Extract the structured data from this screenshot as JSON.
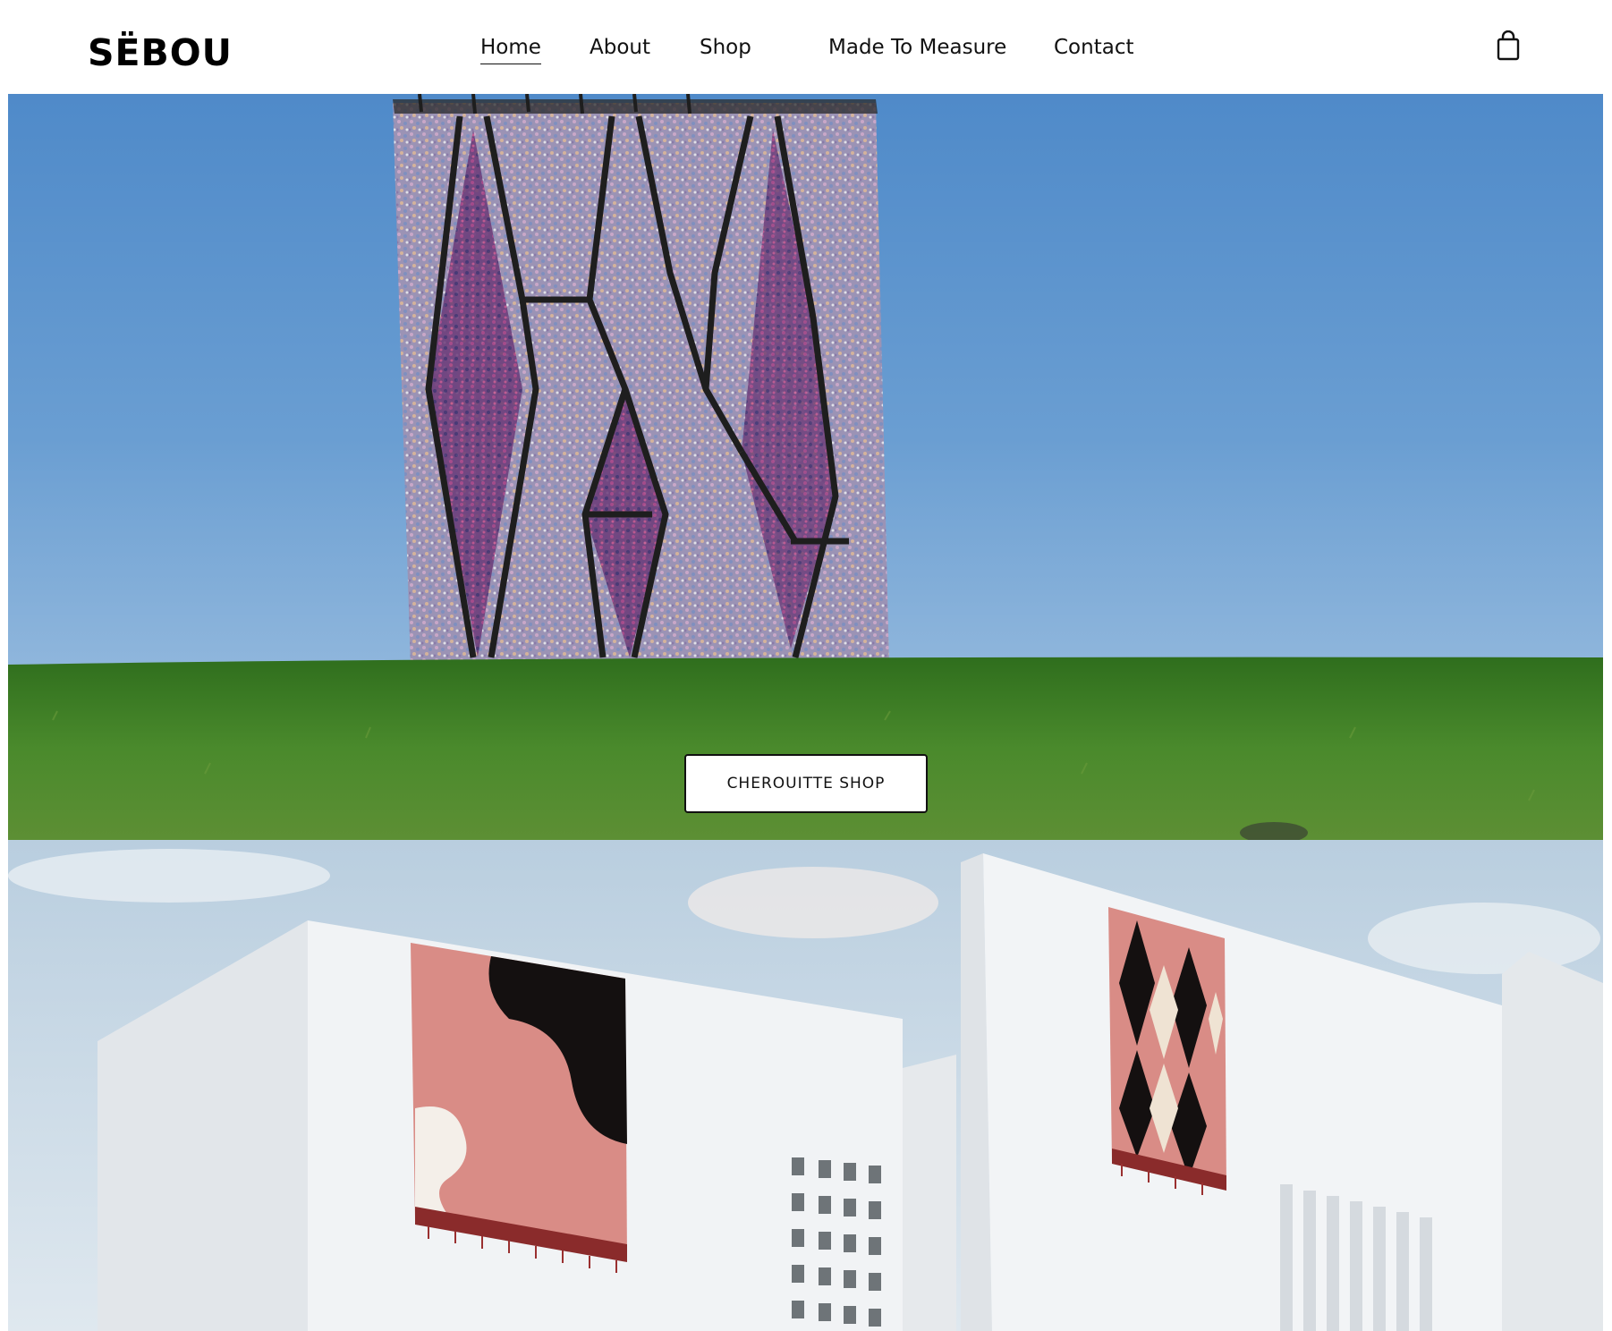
{
  "brand": {
    "name": "SËBOU"
  },
  "nav": {
    "home": "Home",
    "about": "About",
    "shop": "Shop",
    "made_to_measure": "Made To Measure",
    "contact": "Contact",
    "active": "Home"
  },
  "icons": {
    "cart": "shopping-bag-icon"
  },
  "hero": {
    "cta_label": "CHEROUITTE SHOP"
  },
  "colors": {
    "sky": "#5a93cc",
    "grass": "#3e7a25",
    "wall": "#eef2f5",
    "rug_pink": "#d98c86",
    "text": "#111111"
  }
}
